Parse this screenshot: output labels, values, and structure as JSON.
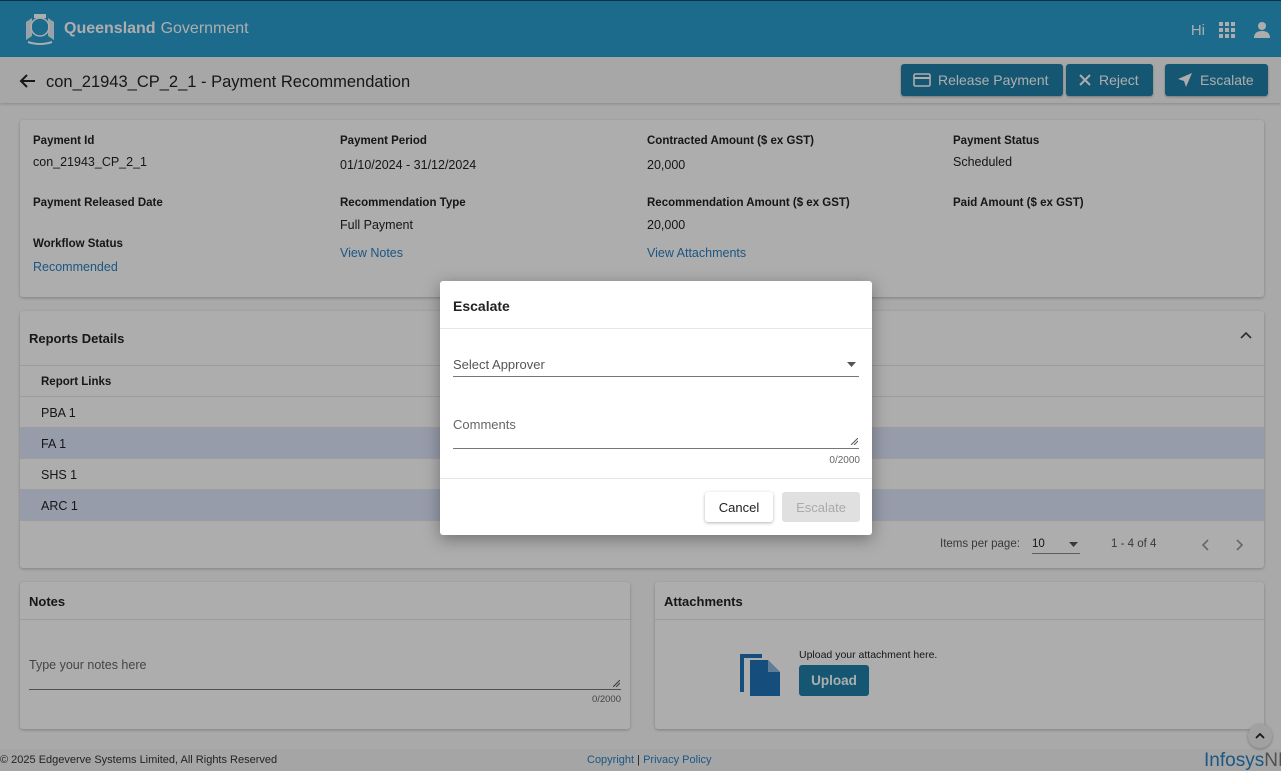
{
  "header": {
    "brand_bold": "Queensland",
    "brand": "Government",
    "greeting": "Hi"
  },
  "titlebar": {
    "title": "con_21943_CP_2_1  - Payment Recommendation",
    "release_label": "Release Payment",
    "reject_label": "Reject",
    "escalate_label": "Escalate"
  },
  "info": {
    "payment_id_label": "Payment Id",
    "payment_id": "con_21943_CP_2_1",
    "payment_period_label": "Payment Period",
    "payment_period": "01/10/2024 - 31/12/2024",
    "contracted_label": "Contracted Amount ($ ex GST)",
    "contracted": "20,000",
    "status_label": "Payment Status",
    "status": "Scheduled",
    "released_label": "Payment Released Date",
    "rec_type_label": "Recommendation Type",
    "rec_type": "Full Payment",
    "rec_amount_label": "Recommendation Amount ($ ex GST)",
    "rec_amount": "20,000",
    "paid_label": "Paid Amount ($ ex GST)",
    "workflow_label": "Workflow Status",
    "workflow": "Recommended",
    "view_notes": "View Notes",
    "view_attachments": "View Attachments"
  },
  "reports": {
    "title": "Reports Details",
    "column": "Report Links",
    "rows": [
      "PBA 1",
      "FA 1",
      "SHS 1",
      "ARC 1"
    ],
    "items_per_page_label": "Items per page:",
    "items_per_page": "10",
    "range": "1 - 4 of 4"
  },
  "notes": {
    "title": "Notes",
    "placeholder": "Type your notes here",
    "counter": "0/2000"
  },
  "attachments": {
    "title": "Attachments",
    "hint": "Upload your attachment here.",
    "upload_label": "Upload"
  },
  "footer": {
    "copyright": "© 2025 Edgeverve Systems Limited, All Rights Reserved",
    "copyright_link": "Copyright",
    "separator": "|",
    "privacy_link": "Privacy Policy",
    "brand": "Infosys",
    "brand_suffix": "NIA"
  },
  "dialog": {
    "title": "Escalate",
    "approver_placeholder": "Select Approver",
    "comments_placeholder": "Comments",
    "counter": "0/2000",
    "cancel_label": "Cancel",
    "escalate_label": "Escalate"
  },
  "colors": {
    "header": "#2b9ecf",
    "primary": "#2081a9",
    "link": "#2a7fc1",
    "row_alt": "#dfe6fb"
  }
}
